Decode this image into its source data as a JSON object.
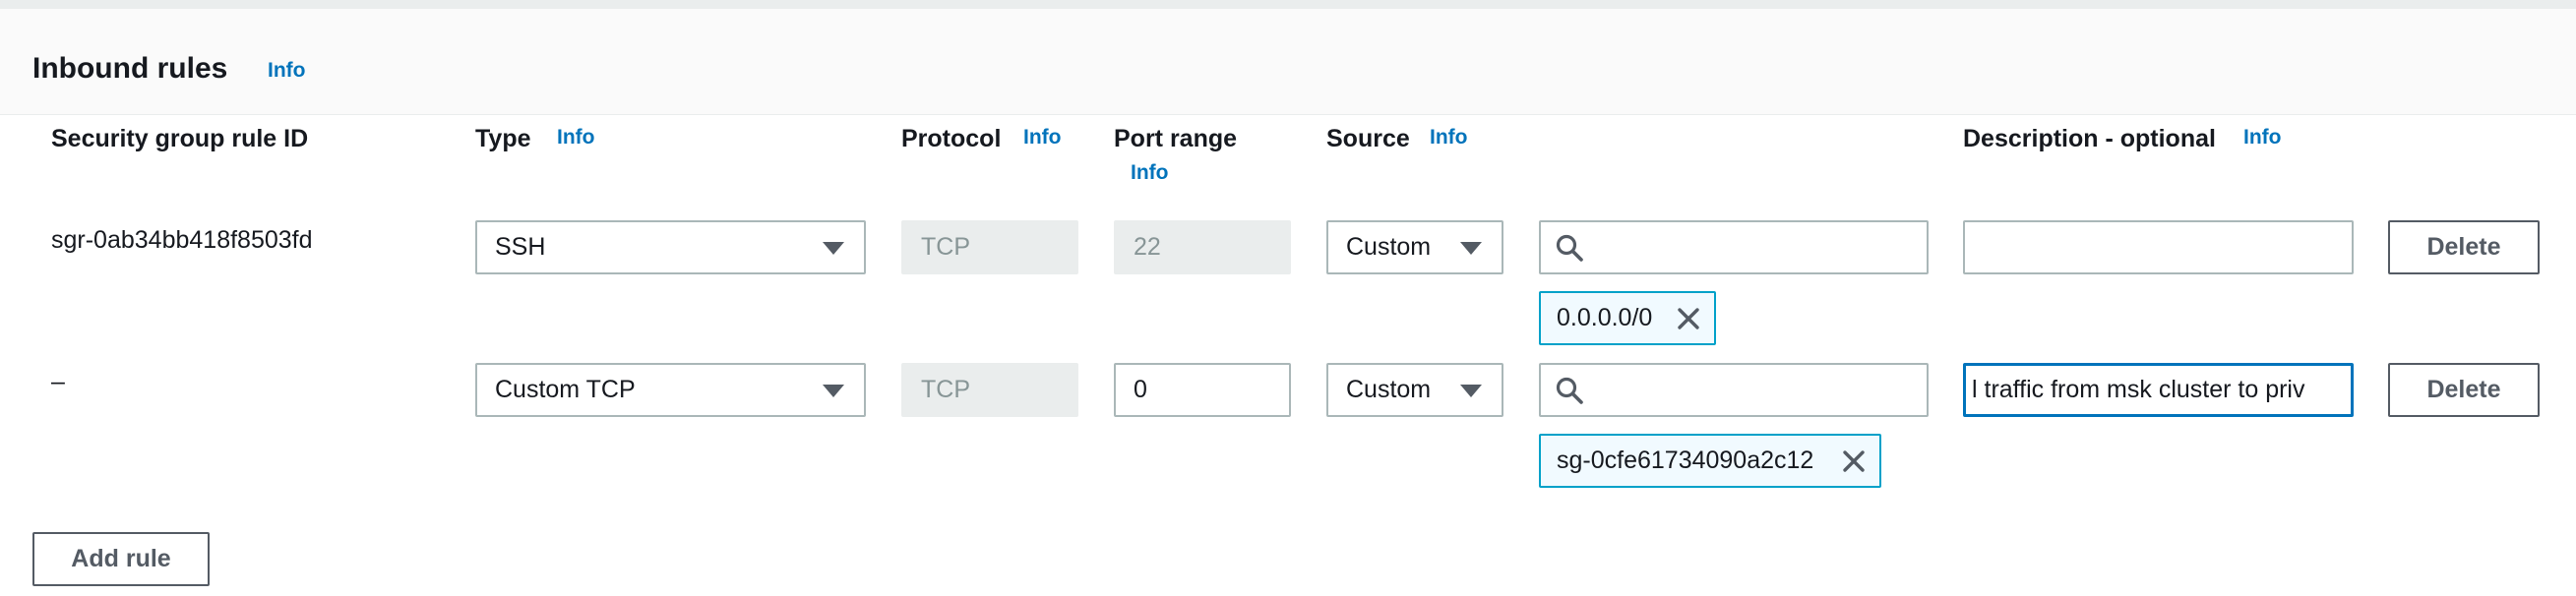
{
  "section": {
    "title": "Inbound rules",
    "info_label": "Info"
  },
  "columns": {
    "rule_id": "Security group rule ID",
    "type": "Type",
    "protocol": "Protocol",
    "port_range": "Port range",
    "source": "Source",
    "description": "Description - optional",
    "info_label": "Info"
  },
  "rules": [
    {
      "rule_id": "sgr-0ab34bb418f8503fd",
      "type": "SSH",
      "protocol": "TCP",
      "port_range": "22",
      "source_type": "Custom",
      "source_search_value": "",
      "source_token": "0.0.0.0/0",
      "description": "",
      "delete_label": "Delete"
    },
    {
      "rule_id": "–",
      "type": "Custom TCP",
      "protocol": "TCP",
      "port_range": "0",
      "source_type": "Custom",
      "source_search_value": "",
      "source_token": "sg-0cfe61734090a2c12",
      "description": "l traffic from msk cluster to priv",
      "delete_label": "Delete"
    }
  ],
  "add_rule_label": "Add rule",
  "colors": {
    "link": "#0073bb",
    "token_border": "#00a1c9",
    "token_bg": "#f1faff",
    "focus_border": "#0073bb"
  }
}
